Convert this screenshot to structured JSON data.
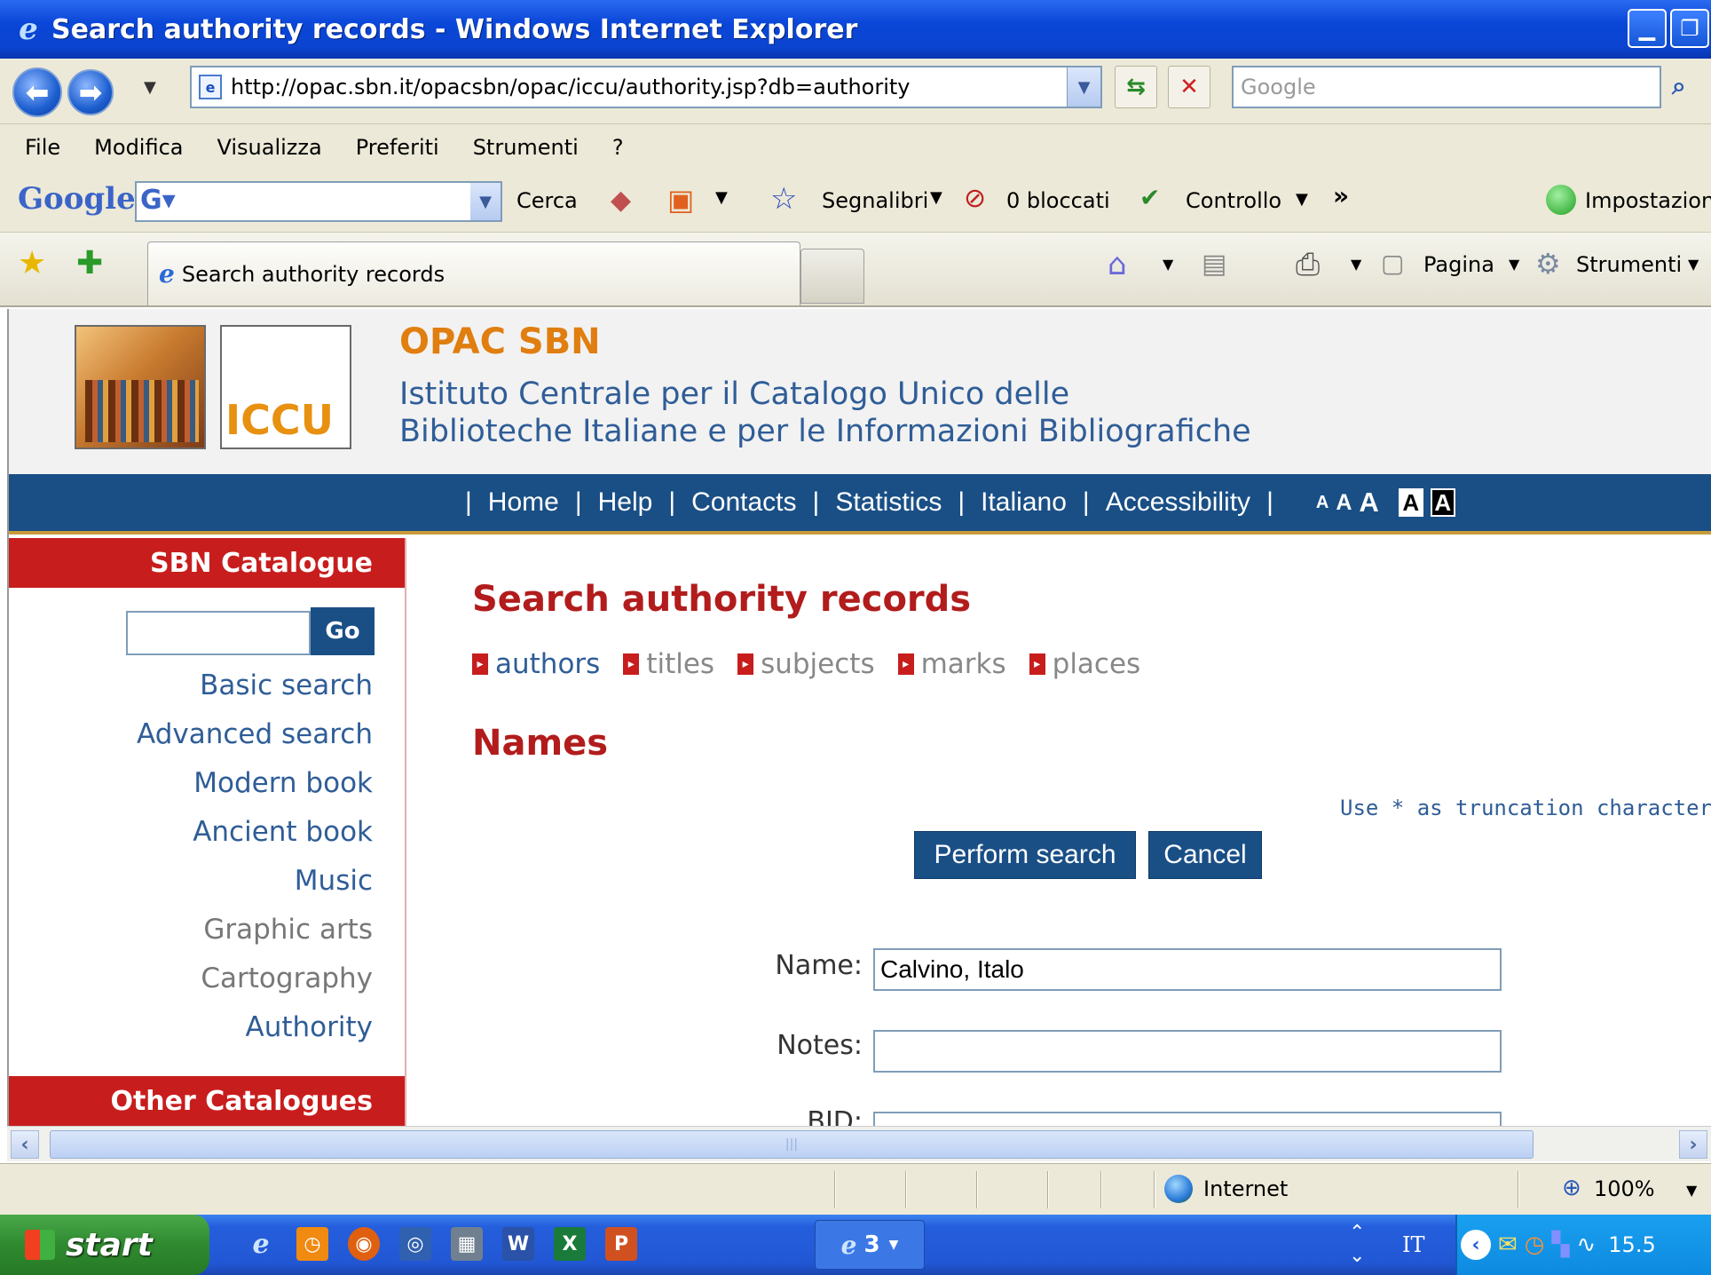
{
  "window": {
    "title": "Search authority records - Windows Internet Explorer",
    "minimize_icon": "minimize-icon",
    "restore_icon": "restore-icon"
  },
  "addressbar": {
    "url": "http://opac.sbn.it/opacsbn/opac/iccu/authority.jsp?db=authority",
    "search_placeholder": "Google"
  },
  "menu": {
    "items": [
      "File",
      "Modifica",
      "Visualizza",
      "Preferiti",
      "Strumenti",
      "?"
    ]
  },
  "google_toolbar": {
    "logo": "Google",
    "search_label": "Cerca",
    "bookmarks_label": "Segnalibri",
    "blocked_label": "0 bloccati",
    "spellcheck_label": "Controllo",
    "more_label": "»",
    "settings_label": "Impostazion"
  },
  "tabs": {
    "active_tab": "Search authority records",
    "page_label": "Pagina",
    "tools_label": "Strumenti"
  },
  "header": {
    "brand": "OPAC SBN",
    "logo_text": "ICCU",
    "institute_line1": "Istituto Centrale per il Catalogo Unico delle",
    "institute_line2": "Biblioteche  Italiane e per le Informazioni Bibliografiche"
  },
  "topnav": {
    "items": [
      "Home",
      "Help",
      "Contacts",
      "Statistics",
      "Italiano",
      "Accessibility"
    ],
    "size_small": "A",
    "size_medium": "A",
    "size_large": "A",
    "contrast_normal": "A",
    "contrast_high": "A"
  },
  "sidebar": {
    "catalogue_heading": "SBN Catalogue",
    "go_label": "Go",
    "links": [
      "Basic search",
      "Advanced search",
      "Modern book",
      "Ancient book",
      "Music",
      "Graphic arts",
      "Cartography",
      "Authority"
    ],
    "other_heading": "Other Catalogues"
  },
  "main": {
    "title": "Search authority records",
    "subnav": [
      "authors",
      "titles",
      "subjects",
      "marks",
      "places"
    ],
    "section_title": "Names",
    "truncation_hint": "Use * as truncation character",
    "search_button": "Perform search",
    "cancel_button": "Cancel",
    "fields": {
      "name_label": "Name:",
      "name_value": "Calvino, Italo",
      "notes_label": "Notes:",
      "notes_value": "",
      "bid_label": "BID:"
    }
  },
  "statusbar": {
    "zone": "Internet",
    "zoom": "100%"
  },
  "taskbar": {
    "start_label": "start",
    "task_label": "3",
    "language": "IT",
    "clock": "15.5"
  }
}
